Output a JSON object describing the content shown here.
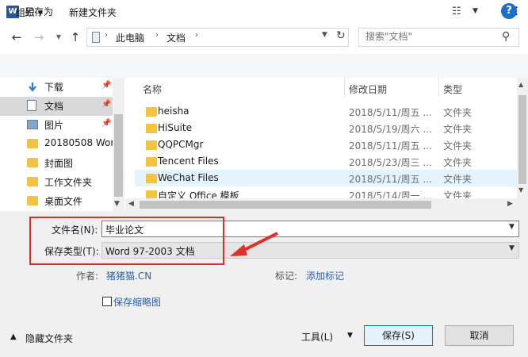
{
  "window": {
    "icon_letter": "W",
    "title": "另存为",
    "close_glyph": "✕"
  },
  "address": {
    "segments": [
      "此电脑",
      "文档"
    ],
    "search_placeholder": "搜索\"文档\""
  },
  "toolbar": {
    "organize": "组织 ▾",
    "new_folder": "新建文件夹",
    "help": "?"
  },
  "nav": {
    "items": [
      {
        "label": "下载",
        "icon": "download-arrow-icon",
        "pinned": true
      },
      {
        "label": "文档",
        "icon": "document-icon",
        "pinned": true,
        "selected": true
      },
      {
        "label": "图片",
        "icon": "picture-icon",
        "pinned": true
      },
      {
        "label": "20180508 Wor",
        "icon": "folder-icon"
      },
      {
        "label": "封面图",
        "icon": "folder-icon"
      },
      {
        "label": "工作文件夹",
        "icon": "folder-icon"
      },
      {
        "label": "桌面文件",
        "icon": "folder-icon"
      }
    ]
  },
  "columns": {
    "name": "名称",
    "date": "修改日期",
    "type": "类型"
  },
  "files": [
    {
      "name": "heisha",
      "date": "2018/5/11/周五 ...",
      "type": "文件夹"
    },
    {
      "name": "HiSuite",
      "date": "2018/5/19/周六 ...",
      "type": "文件夹"
    },
    {
      "name": "QQPCMgr",
      "date": "2018/5/11/周五 ...",
      "type": "文件夹"
    },
    {
      "name": "Tencent Files",
      "date": "2018/5/23/周三 ...",
      "type": "文件夹"
    },
    {
      "name": "WeChat Files",
      "date": "2018/5/11/周五 ...",
      "type": "文件夹",
      "hover": true
    },
    {
      "name": "自定义 Office 模板",
      "date": "2018/5/14/周一 ...",
      "type": "文件夹"
    }
  ],
  "form": {
    "filename_label": "文件名(N):",
    "filename_value": "毕业论文",
    "filetype_label": "保存类型(T):",
    "filetype_value": "Word 97-2003 文档",
    "author_label": "作者:",
    "author_value": "猪猪猫.CN",
    "tags_label": "标记:",
    "tags_value": "添加标记",
    "thumbnail_label": "保存缩略图"
  },
  "footer": {
    "hide_folders": "隐藏文件夹",
    "tools": "工具(L)",
    "save": "保存(S)",
    "cancel": "取消"
  },
  "colors": {
    "highlight": "#e0302b",
    "link": "#2a62b0",
    "folder": "#f3c342"
  }
}
